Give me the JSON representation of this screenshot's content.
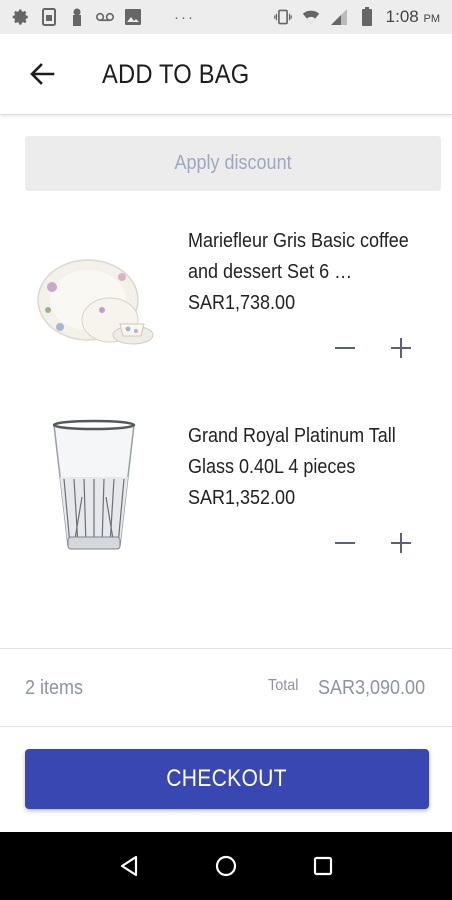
{
  "status_bar": {
    "time": "1:08",
    "ampm": "PM",
    "icons": [
      "settings-icon",
      "sim-card-icon",
      "usb-icon",
      "voicemail-icon",
      "image-icon",
      "more-dots-icon",
      "vibrate-icon",
      "wifi-icon",
      "signal-icon",
      "battery-icon"
    ],
    "more": "···"
  },
  "header": {
    "title": "ADD TO BAG"
  },
  "discount": {
    "label": "Apply discount"
  },
  "cart": {
    "items": [
      {
        "name": "Mariefleur Gris Basic coffee and dessert Set 6  …",
        "price": "SAR1,738.00",
        "image": "plate-set-image"
      },
      {
        "name": "Grand Royal Platinum Tall Glass 0.40L 4 pieces",
        "price": "SAR1,352.00",
        "image": "glass-image"
      }
    ],
    "minus_symbol": "−",
    "plus_symbol": "+"
  },
  "summary": {
    "items_count": "2 items",
    "total_label": "Total",
    "total_value": "SAR3,090.00"
  },
  "checkout": {
    "label": "CHECKOUT"
  },
  "colors": {
    "primary": "#3847b2",
    "muted_text": "#8a93a8",
    "discount_bg": "#ececec"
  }
}
